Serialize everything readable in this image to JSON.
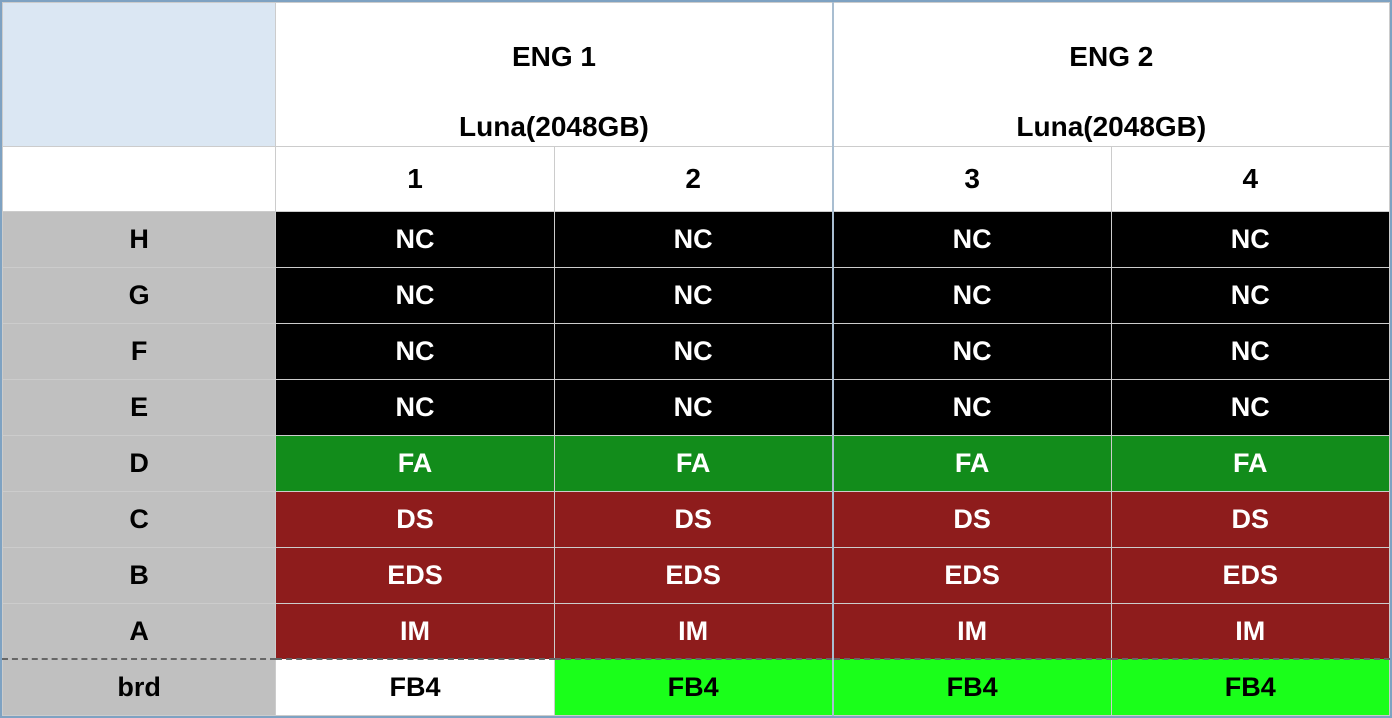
{
  "groups": [
    {
      "title1": "ENG 1",
      "title2": "Luna(2048GB)"
    },
    {
      "title1": "ENG 2",
      "title2": "Luna(2048GB)"
    }
  ],
  "cols": [
    "1",
    "2",
    "3",
    "4"
  ],
  "rows": [
    {
      "label": "H",
      "cells": [
        {
          "v": "NC",
          "c": "nc"
        },
        {
          "v": "NC",
          "c": "nc"
        },
        {
          "v": "NC",
          "c": "nc"
        },
        {
          "v": "NC",
          "c": "nc"
        }
      ]
    },
    {
      "label": "G",
      "cells": [
        {
          "v": "NC",
          "c": "nc"
        },
        {
          "v": "NC",
          "c": "nc"
        },
        {
          "v": "NC",
          "c": "nc"
        },
        {
          "v": "NC",
          "c": "nc"
        }
      ]
    },
    {
      "label": "F",
      "cells": [
        {
          "v": "NC",
          "c": "nc"
        },
        {
          "v": "NC",
          "c": "nc"
        },
        {
          "v": "NC",
          "c": "nc"
        },
        {
          "v": "NC",
          "c": "nc"
        }
      ]
    },
    {
      "label": "E",
      "cells": [
        {
          "v": "NC",
          "c": "nc"
        },
        {
          "v": "NC",
          "c": "nc"
        },
        {
          "v": "NC",
          "c": "nc"
        },
        {
          "v": "NC",
          "c": "nc"
        }
      ]
    },
    {
      "label": "D",
      "cells": [
        {
          "v": "FA",
          "c": "fa"
        },
        {
          "v": "FA",
          "c": "fa"
        },
        {
          "v": "FA",
          "c": "fa"
        },
        {
          "v": "FA",
          "c": "fa"
        }
      ]
    },
    {
      "label": "C",
      "cells": [
        {
          "v": "DS",
          "c": "ds"
        },
        {
          "v": "DS",
          "c": "ds"
        },
        {
          "v": "DS",
          "c": "ds"
        },
        {
          "v": "DS",
          "c": "ds"
        }
      ]
    },
    {
      "label": "B",
      "cells": [
        {
          "v": "EDS",
          "c": "eds"
        },
        {
          "v": "EDS",
          "c": "eds"
        },
        {
          "v": "EDS",
          "c": "eds"
        },
        {
          "v": "EDS",
          "c": "eds"
        }
      ]
    },
    {
      "label": "A",
      "cells": [
        {
          "v": "IM",
          "c": "im"
        },
        {
          "v": "IM",
          "c": "im"
        },
        {
          "v": "IM",
          "c": "im"
        },
        {
          "v": "IM",
          "c": "im"
        }
      ]
    }
  ],
  "footer": {
    "label": "brd",
    "cells": [
      {
        "v": "FB4",
        "c": "fb-w"
      },
      {
        "v": "FB4",
        "c": "fb-g"
      },
      {
        "v": "FB4",
        "c": "fb-g"
      },
      {
        "v": "FB4",
        "c": "fb-g"
      }
    ]
  },
  "chart_data": {
    "type": "table",
    "col_groups": [
      "ENG 1 Luna(2048GB)",
      "ENG 1 Luna(2048GB)",
      "ENG 2 Luna(2048GB)",
      "ENG 2 Luna(2048GB)"
    ],
    "cols": [
      "1",
      "2",
      "3",
      "4"
    ],
    "rows": [
      "H",
      "G",
      "F",
      "E",
      "D",
      "C",
      "B",
      "A",
      "brd"
    ],
    "values": [
      [
        "NC",
        "NC",
        "NC",
        "NC"
      ],
      [
        "NC",
        "NC",
        "NC",
        "NC"
      ],
      [
        "NC",
        "NC",
        "NC",
        "NC"
      ],
      [
        "NC",
        "NC",
        "NC",
        "NC"
      ],
      [
        "FA",
        "FA",
        "FA",
        "FA"
      ],
      [
        "DS",
        "DS",
        "DS",
        "DS"
      ],
      [
        "EDS",
        "EDS",
        "EDS",
        "EDS"
      ],
      [
        "IM",
        "IM",
        "IM",
        "IM"
      ],
      [
        "FB4",
        "FB4",
        "FB4",
        "FB4"
      ]
    ],
    "status_colors": {
      "NC": "#000000",
      "FA": "#128c1b",
      "DS": "#8e1c1c",
      "EDS": "#8e1c1c",
      "IM": "#8e1c1c",
      "FB4_white": "#ffffff",
      "FB4_green": "#1aff1a"
    }
  }
}
